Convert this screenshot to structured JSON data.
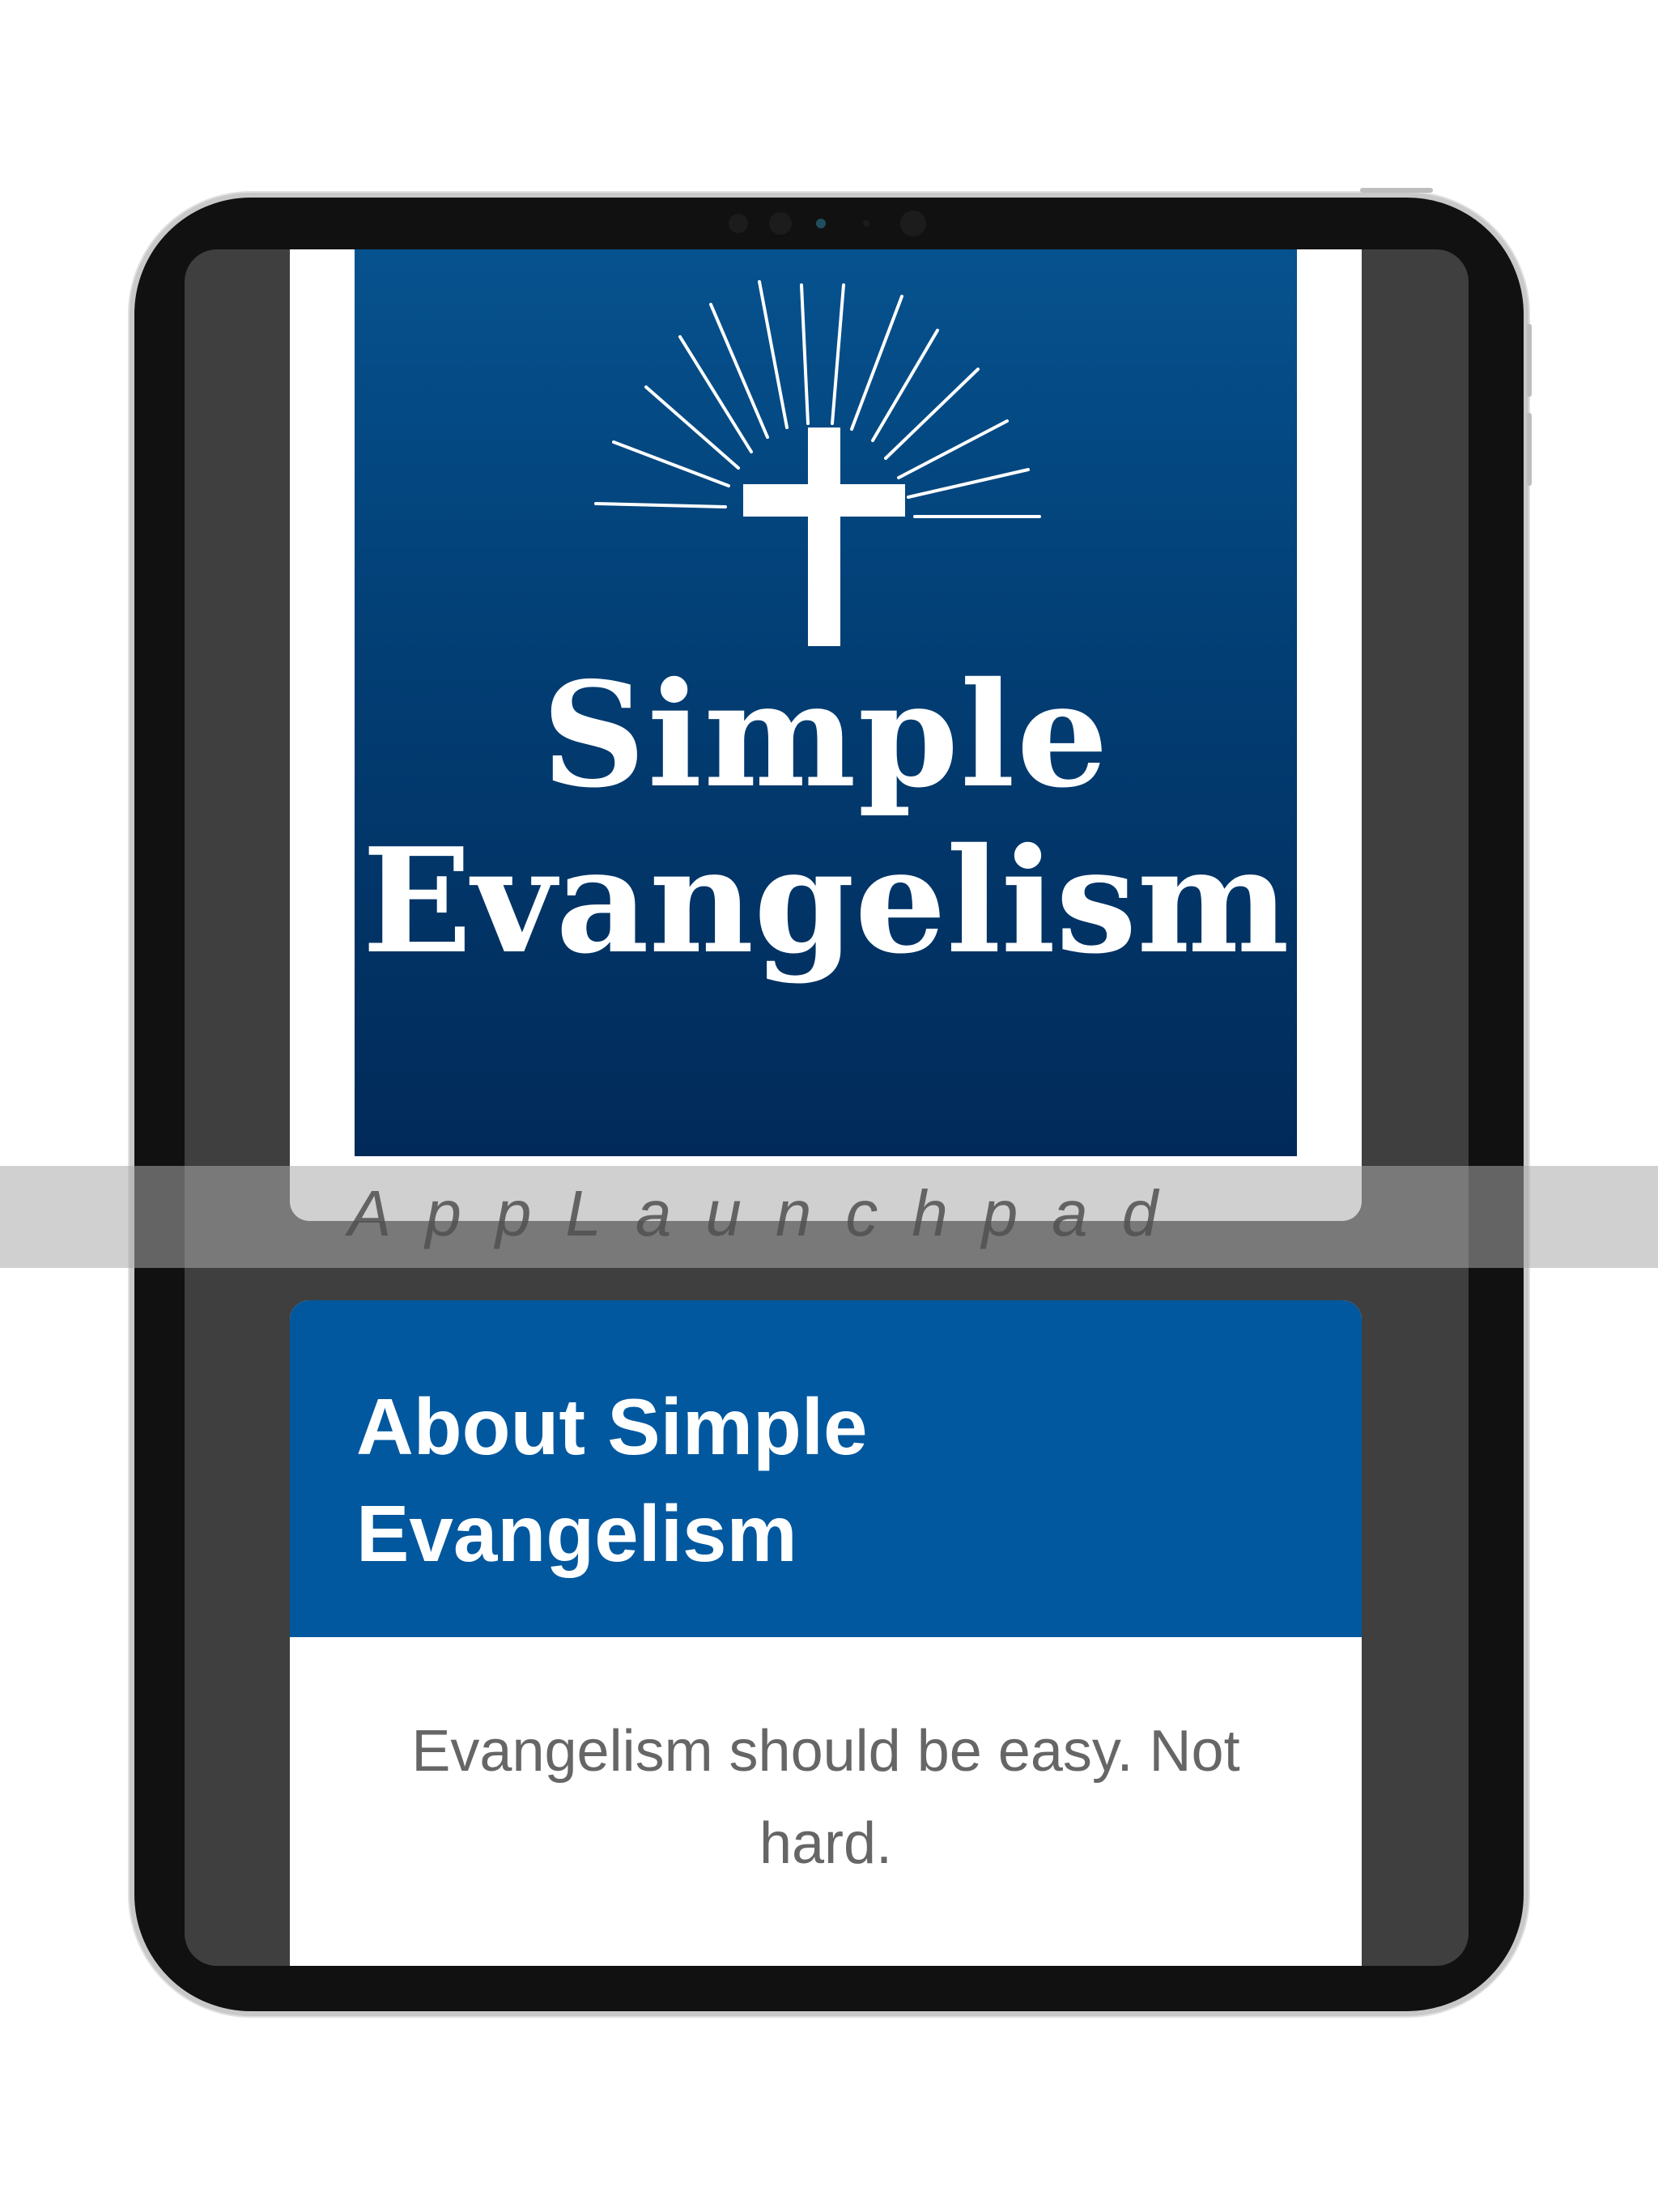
{
  "hero": {
    "title_line1": "Simple",
    "title_line2": "Evangelism",
    "icon": "cross-icon"
  },
  "watermark": {
    "text": "AppLaunchpad"
  },
  "about": {
    "title": "About Simple Evangelism",
    "body": "Evangelism should be easy. Not hard."
  },
  "colors": {
    "hero_blue_top": "#06528f",
    "hero_blue_bottom": "#012a59",
    "about_header_blue": "#01589f",
    "body_text": "#666666"
  }
}
